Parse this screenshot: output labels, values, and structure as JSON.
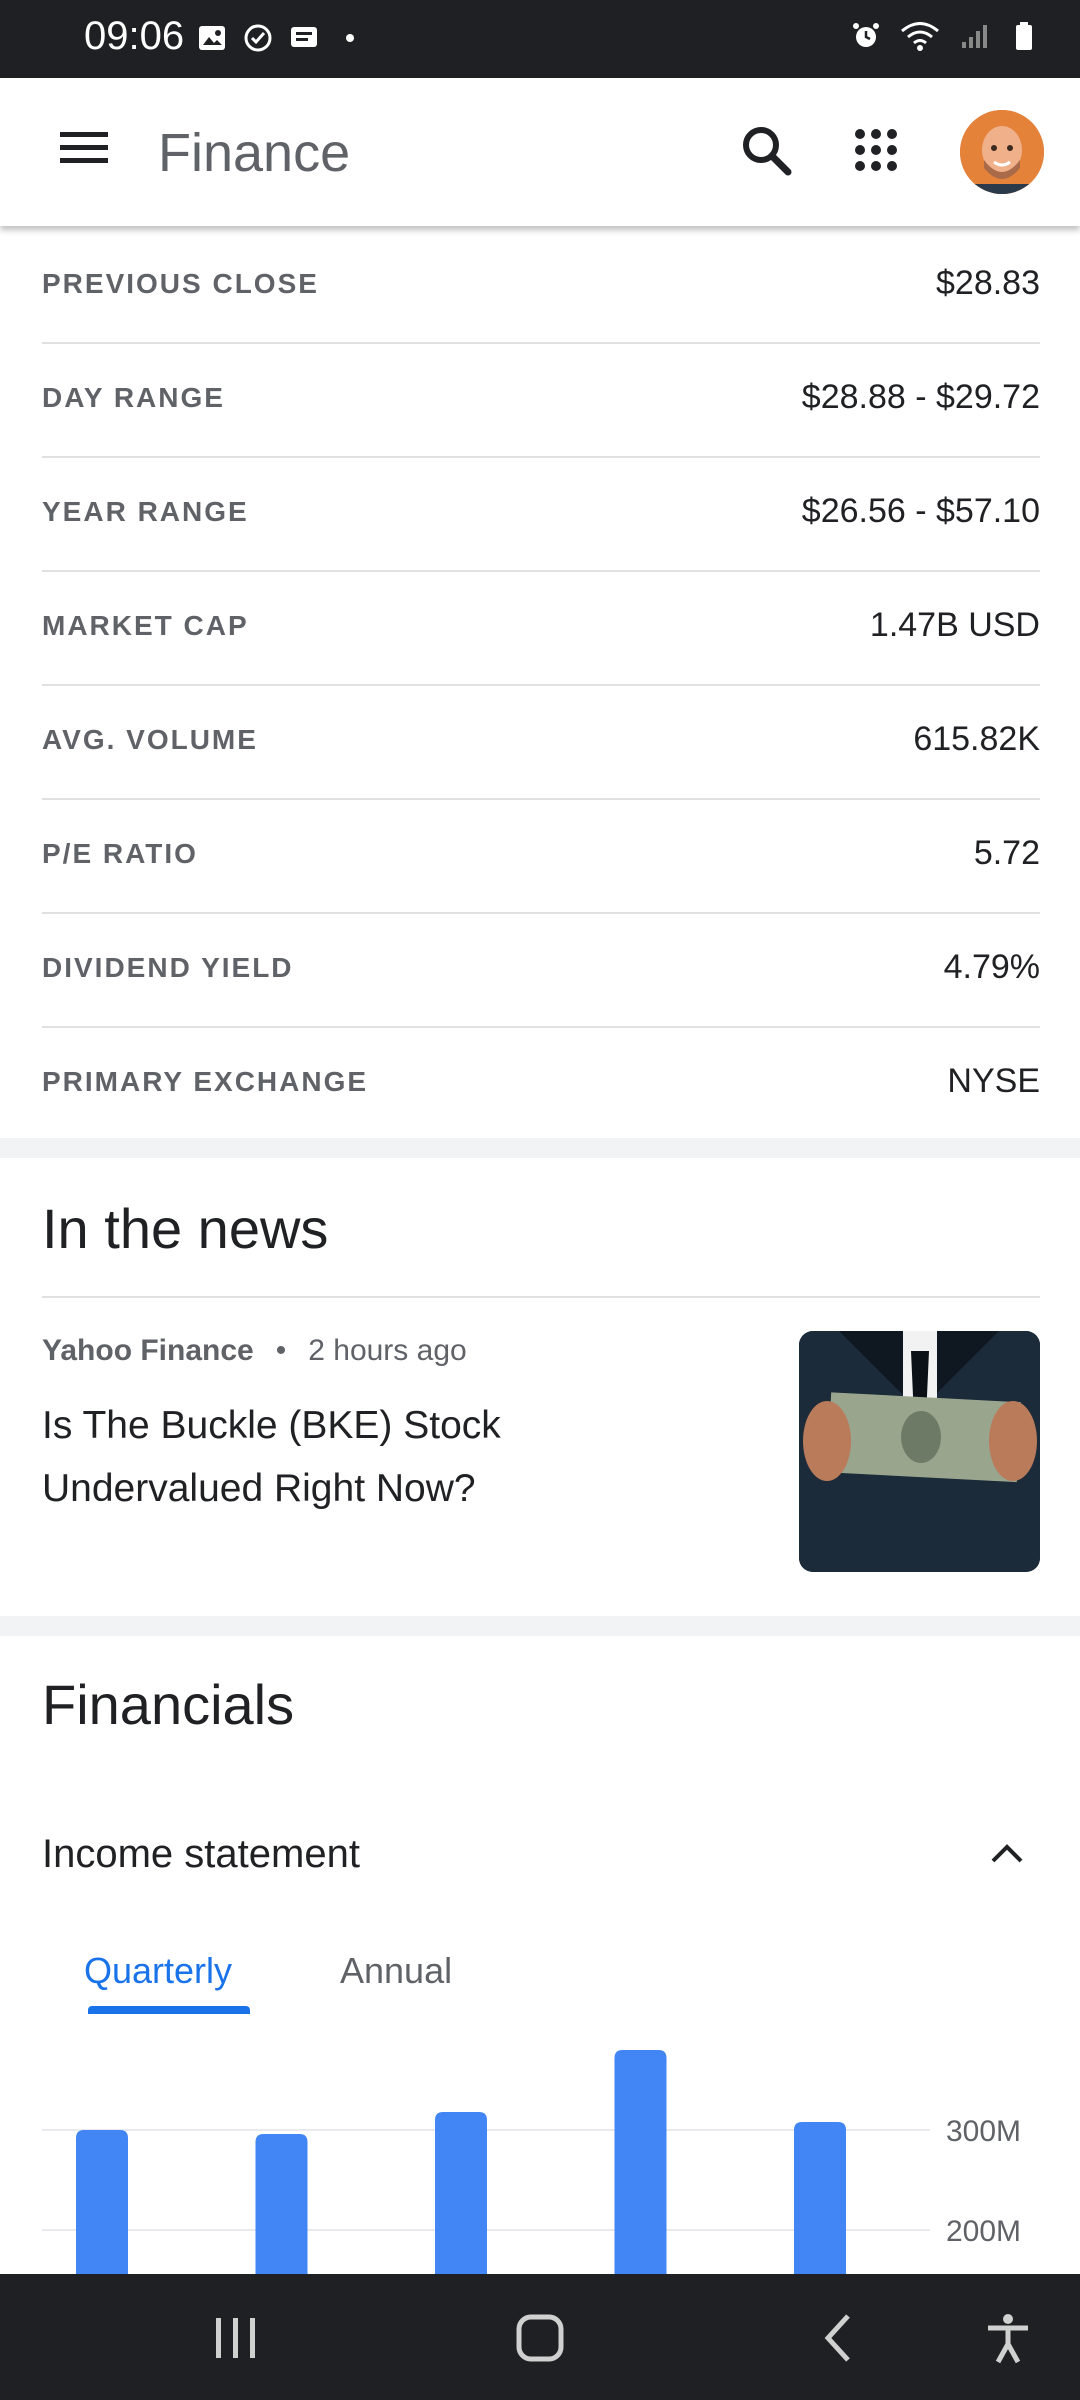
{
  "status_bar": {
    "time": "09:06"
  },
  "app_bar": {
    "title": "Finance"
  },
  "stats": [
    {
      "label": "PREVIOUS CLOSE",
      "value": "$28.83"
    },
    {
      "label": "DAY RANGE",
      "value": "$28.88 - $29.72"
    },
    {
      "label": "YEAR RANGE",
      "value": "$26.56 - $57.10"
    },
    {
      "label": "MARKET CAP",
      "value": "1.47B USD"
    },
    {
      "label": "AVG. VOLUME",
      "value": "615.82K"
    },
    {
      "label": "P/E RATIO",
      "value": "5.72"
    },
    {
      "label": "DIVIDEND YIELD",
      "value": "4.79%"
    },
    {
      "label": "PRIMARY EXCHANGE",
      "value": "NYSE"
    }
  ],
  "news": {
    "title": "In the news",
    "item": {
      "source": "Yahoo Finance",
      "separator": "•",
      "time": "2 hours ago",
      "headline": "Is The Buckle (BKE) Stock Undervalued Right Now?"
    }
  },
  "financials": {
    "title": "Financials",
    "section": "Income statement",
    "tabs": [
      "Quarterly",
      "Annual"
    ],
    "active_tab": "Quarterly"
  },
  "chart_data": {
    "type": "bar",
    "values": [
      300000000,
      296000000,
      318000000,
      380000000,
      308000000
    ],
    "y_ticks": [
      {
        "value": 300000000,
        "label": "300M"
      },
      {
        "value": 200000000,
        "label": "200M"
      }
    ],
    "color": "#4285f4"
  }
}
